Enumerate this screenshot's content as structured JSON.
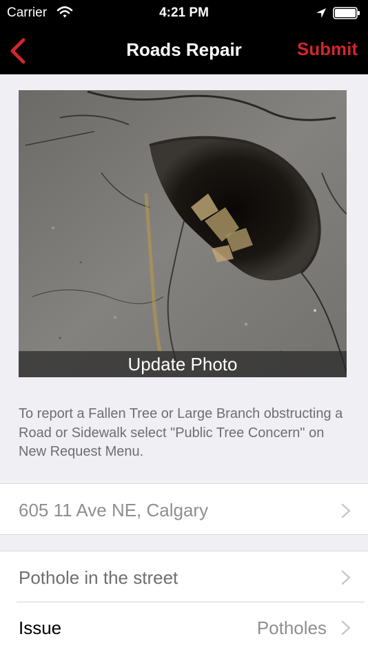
{
  "status_bar": {
    "carrier": "Carrier",
    "time": "4:21 PM",
    "icons": [
      "wifi-icon",
      "location-arrow-icon",
      "battery-icon"
    ]
  },
  "nav": {
    "back_icon": "chevron-left-icon",
    "title": "Roads Repair",
    "submit_label": "Submit",
    "accent_color": "#d2262c"
  },
  "photo": {
    "update_label": "Update Photo"
  },
  "info_text": "To report a Fallen Tree or Large Branch obstructing a Road or Sidewalk select \"Public Tree Concern\" on New Request Menu.",
  "form": {
    "address": "605 11 Ave NE, Calgary",
    "description": "Pothole in the street",
    "issue_label": "Issue",
    "issue_value": "Potholes"
  }
}
